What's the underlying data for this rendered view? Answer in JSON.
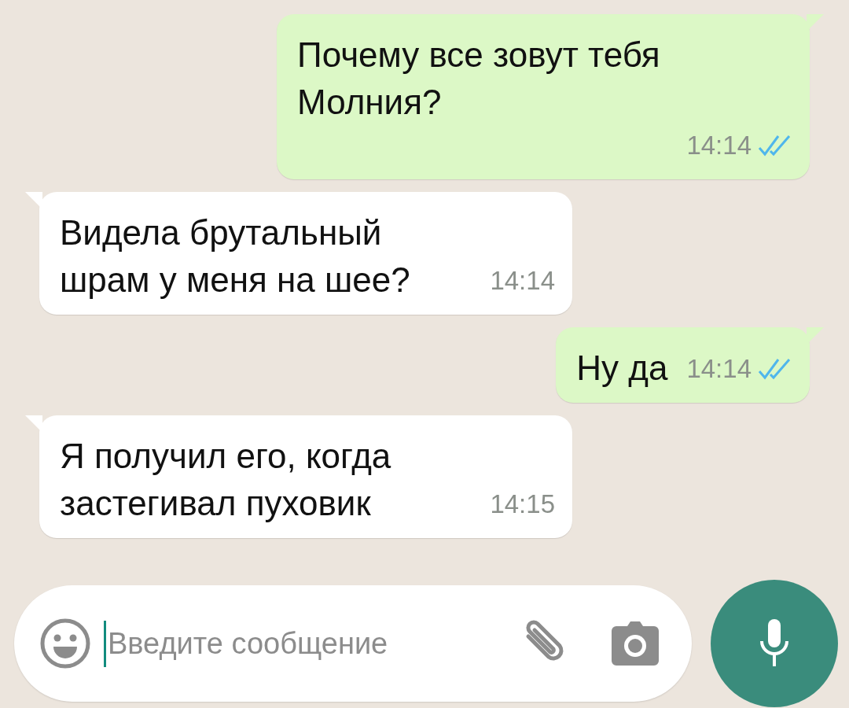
{
  "messages": [
    {
      "kind": "outgoing",
      "text": "Почему все зовут тебя Молния?",
      "time": "14:14",
      "read": true
    },
    {
      "kind": "incoming",
      "text": "Видела брутальный шрам у меня на шее?",
      "time": "14:14"
    },
    {
      "kind": "outgoing",
      "text": "Ну да",
      "time": "14:14",
      "read": true
    },
    {
      "kind": "incoming",
      "text": "Я получил его, когда застегивал пуховик",
      "time": "14:15"
    }
  ],
  "composer": {
    "placeholder": "Введите сообщение"
  }
}
